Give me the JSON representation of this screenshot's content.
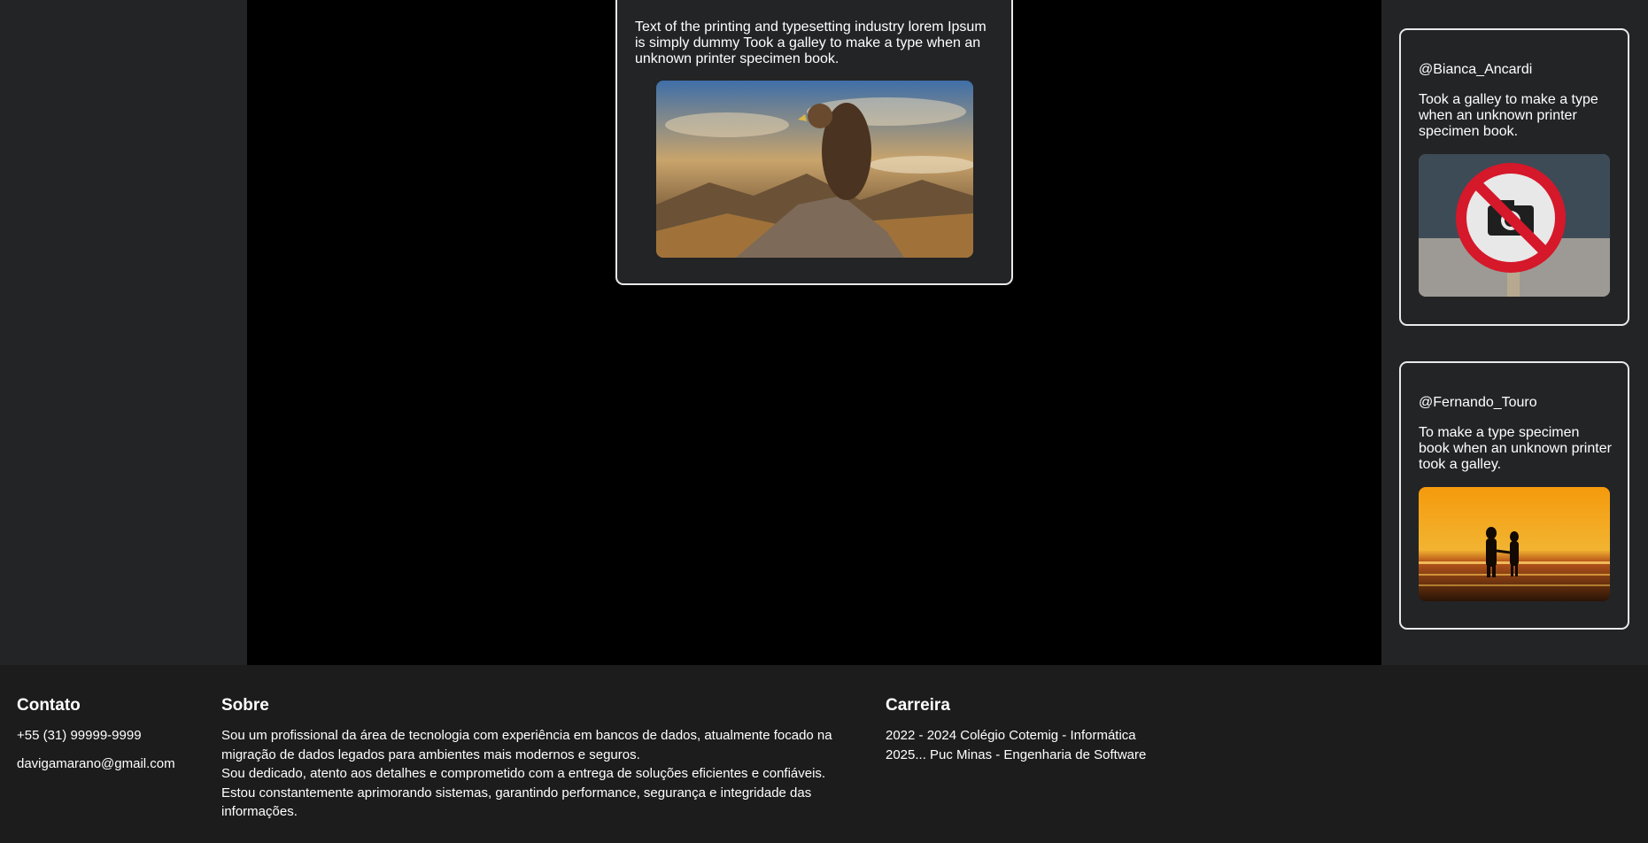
{
  "post": {
    "text": "Text of the printing and typesetting industry lorem Ipsum is simply dummy Took a galley to make a type when an unknown printer specimen book.",
    "image": "eagle-on-mountain-photo"
  },
  "suggestions": [
    {
      "handle": "@Bianca_Ancardi",
      "text": "Took a galley to make a type when an unknown printer specimen book.",
      "image": "no-photography-sign-photo"
    },
    {
      "handle": "@Fernando_Touro",
      "text": "To make a type specimen book when an unknown printer took a galley.",
      "image": "couple-sunset-beach-photo"
    }
  ],
  "footer": {
    "contato": {
      "title": "Contato",
      "phone": "+55 (31) 99999-9999",
      "email": "davigamarano@gmail.com"
    },
    "sobre": {
      "title": "Sobre",
      "line1": "Sou um profissional da área de tecnologia com experiência em bancos de dados, atualmente focado na migração de dados legados para ambientes mais modernos e seguros.",
      "line2": "Sou dedicado, atento aos detalhes e comprometido com a entrega de soluções eficientes e confiáveis.",
      "line3": "Estou constantemente aprimorando sistemas, garantindo performance, segurança e integridade das informações."
    },
    "carreira": {
      "title": "Carreira",
      "item1": "2022 - 2024 Colégio Cotemig - Informática",
      "item2": "2025... Puc Minas - Engenharia de Software"
    }
  }
}
